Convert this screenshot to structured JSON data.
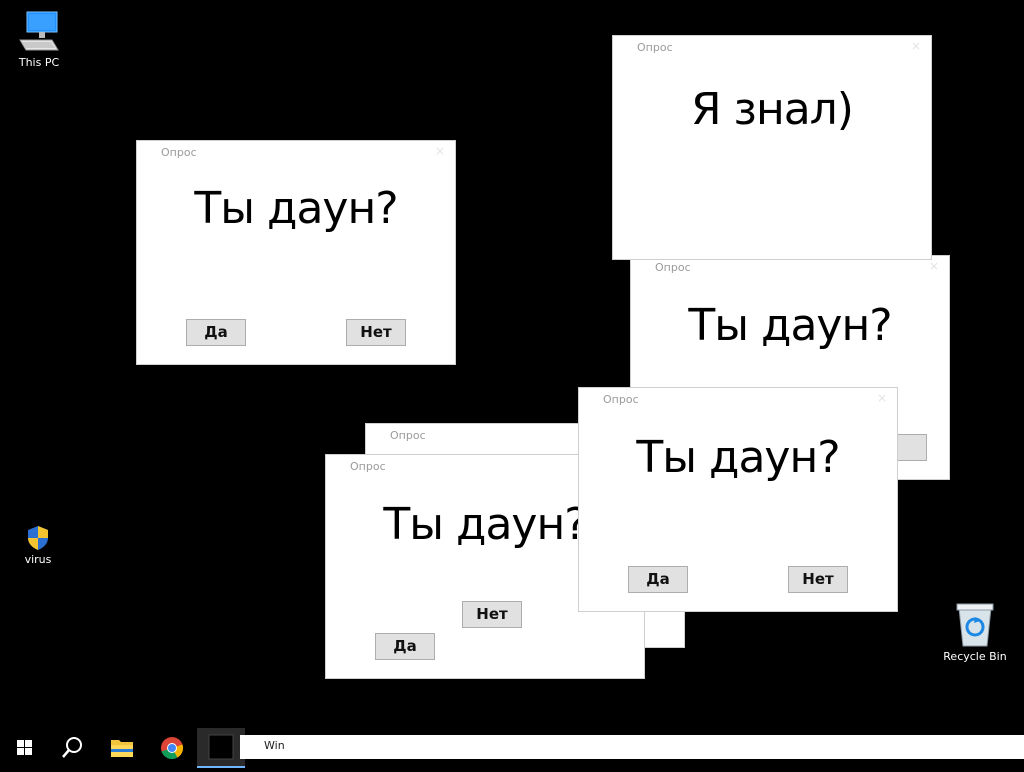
{
  "desktop": {
    "icons": [
      {
        "label": "This PC",
        "icon": "computer-monitor-icon"
      },
      {
        "label": "virus",
        "icon": "uac-shield-icon"
      },
      {
        "label": "Recycle Bin",
        "icon": "recycle-bin-icon"
      }
    ]
  },
  "dialogs": [
    {
      "title": "Опрос",
      "close": "×",
      "message": "Ты даун?",
      "yes": "Да",
      "no": "Нет"
    },
    {
      "title": "Опрос",
      "close": "×",
      "message": "Я знал)"
    },
    {
      "title": "Опрос",
      "close": "×",
      "message": "Ты даун?"
    },
    {
      "title": "Опрос"
    },
    {
      "title": "Опрос",
      "message": "Ты даун?",
      "yes": "Да",
      "no": "Нет"
    },
    {
      "title": "Опрос",
      "close": "×",
      "message": "Ты даун?",
      "yes": "Да",
      "no": "Нет"
    }
  ],
  "taskbar": {
    "start_icon": "windows-start-icon",
    "search_icon": "search-icon",
    "pinned": [
      "file-explorer-icon",
      "chrome-icon",
      "app-window-icon"
    ],
    "window_field_text": "Win"
  },
  "colors": {
    "desktop_bg": "#000000",
    "dialog_bg": "#ffffff",
    "button_bg": "#e1e1e1",
    "accent_blue": "#0078d7"
  }
}
